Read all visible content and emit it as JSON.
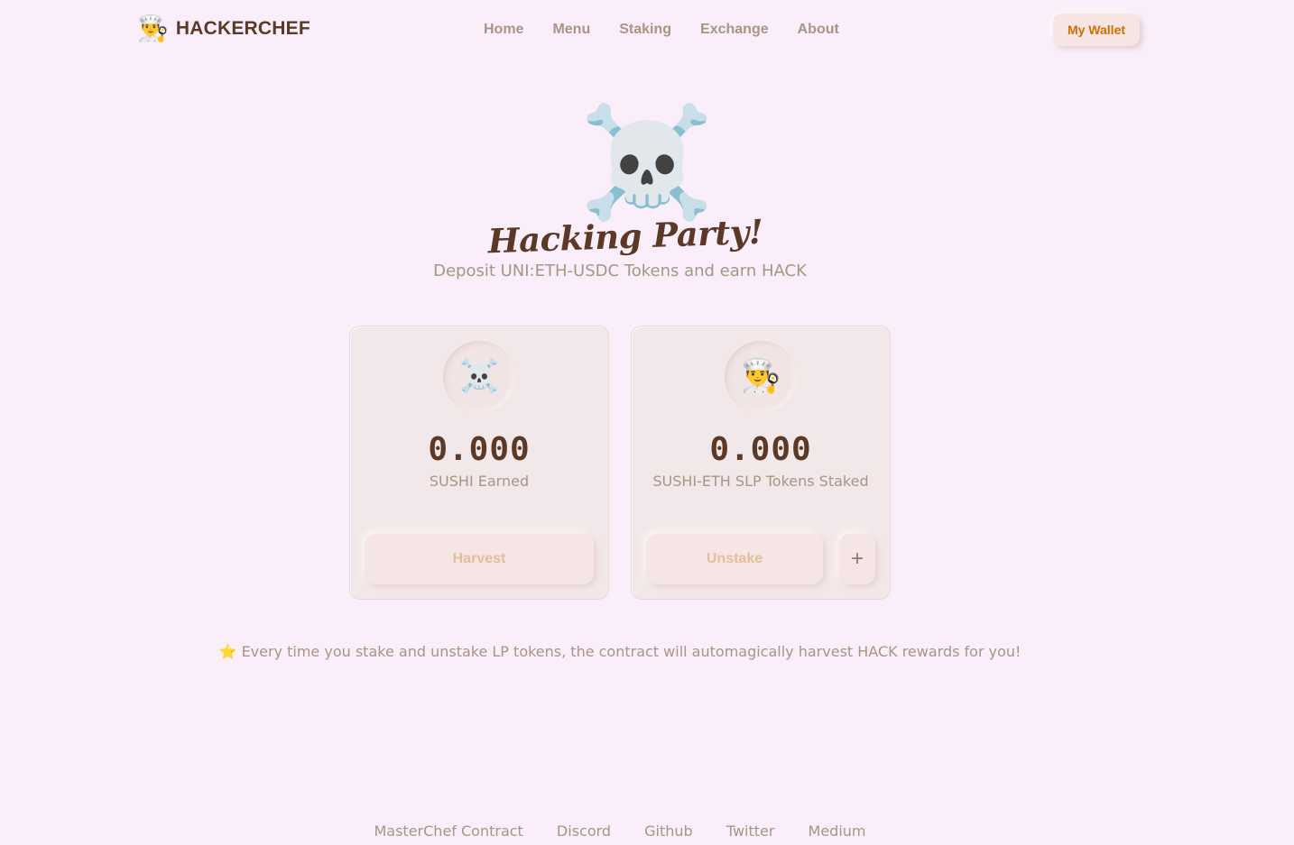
{
  "header": {
    "logo_icon": "chef-icon",
    "logo_glyph": "👨‍🍳",
    "logo_text": "HACKERCHEF",
    "nav": [
      "Home",
      "Menu",
      "Staking",
      "Exchange",
      "About"
    ],
    "wallet_label": "My Wallet"
  },
  "hero": {
    "icon": "skull-crossbones-icon",
    "glyph": "☠️",
    "title": "Hacking Party!",
    "subtitle": "Deposit UNI:ETH-USDC Tokens and earn HACK"
  },
  "cards": [
    {
      "avatar_icon": "skull-crossbones-icon",
      "avatar_glyph": "☠️",
      "value": "0.000",
      "label": "SUSHI Earned",
      "button": "Harvest"
    },
    {
      "avatar_icon": "chef-detective-icon",
      "avatar_glyph": "👨‍🍳",
      "value": "0.000",
      "label": "SUSHI-ETH SLP Tokens Staked",
      "button": "Unstake",
      "plus_button": "+"
    }
  ],
  "note": "⭐ Every time you stake and unstake LP tokens, the contract will automagically harvest HACK rewards for you!",
  "footer": [
    "MasterChef Contract",
    "Discord",
    "Github",
    "Twitter",
    "Medium"
  ],
  "colors": {
    "background": "#f9eefa",
    "brand": "#5b3926",
    "muted": "#aa9584",
    "accent": "#d16c00"
  }
}
